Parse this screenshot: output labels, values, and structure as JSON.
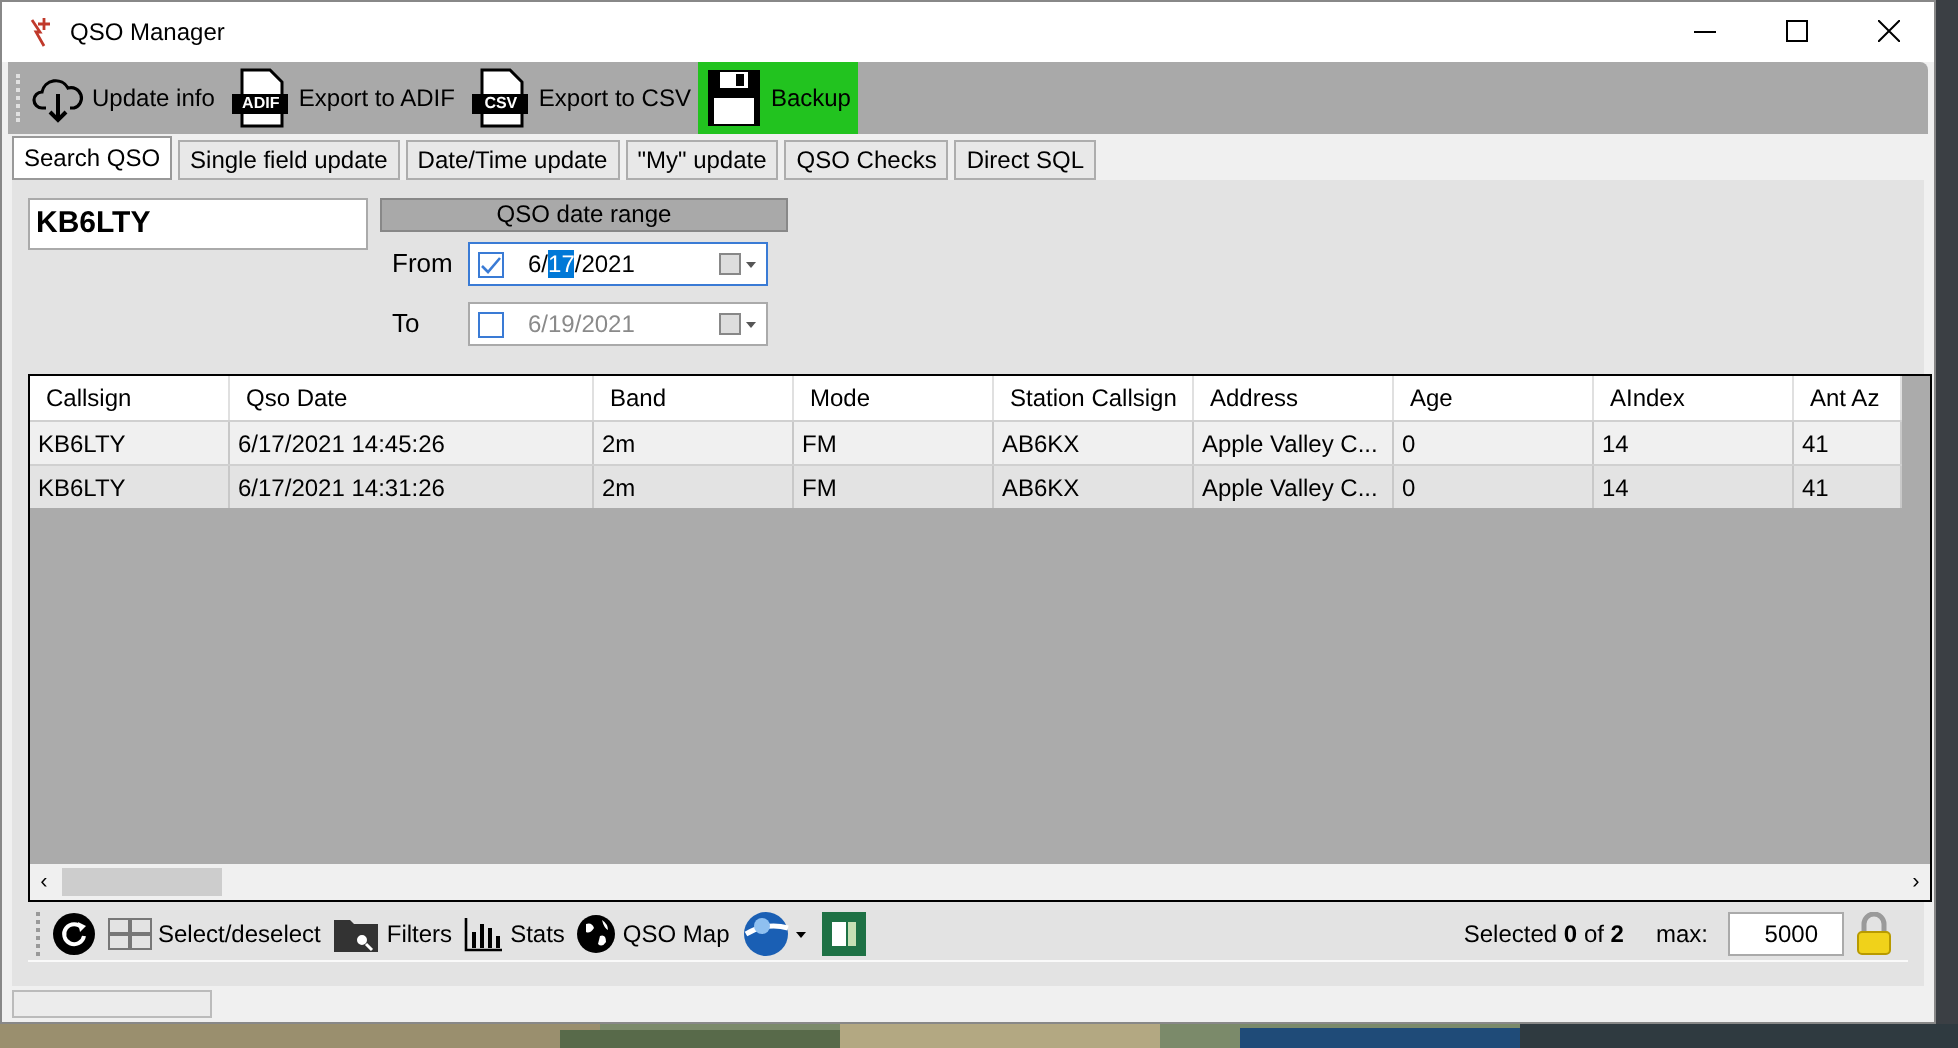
{
  "window": {
    "title": "QSO Manager"
  },
  "toolbar": [
    {
      "label": "Update info",
      "kind": "cloud",
      "highlighted": false
    },
    {
      "label": "Export to ADIF",
      "kind": "file",
      "icon_text": "ADIF",
      "highlighted": false
    },
    {
      "label": "Export to CSV",
      "kind": "file",
      "icon_text": "CSV",
      "highlighted": false
    },
    {
      "label": "Backup",
      "kind": "floppy",
      "highlighted": true
    }
  ],
  "tabs": [
    {
      "label": "Search QSO",
      "selected": true
    },
    {
      "label": "Single field update",
      "selected": false
    },
    {
      "label": "Date/Time update",
      "selected": false
    },
    {
      "label": "\"My\" update",
      "selected": false
    },
    {
      "label": "QSO Checks",
      "selected": false
    },
    {
      "label": "Direct SQL",
      "selected": false
    }
  ],
  "search": {
    "callsign": "KB6LTY",
    "date_range_title": "QSO date range",
    "dates": [
      {
        "label": "From",
        "checked": true,
        "parts": [
          {
            "text": "6/",
            "selected": false
          },
          {
            "text": "17",
            "selected": true
          },
          {
            "text": "/2021",
            "selected": false
          }
        ]
      },
      {
        "label": "To",
        "checked": false,
        "parts": [
          {
            "text": "6/19/2021",
            "selected": false
          }
        ]
      }
    ]
  },
  "table": {
    "columns": [
      "Callsign",
      "Qso Date",
      "Band",
      "Mode",
      "Station Callsign",
      "Address",
      "Age",
      "AIndex",
      "Ant Az"
    ],
    "scroll_left": "‹",
    "scroll_right": "›",
    "rows": [
      [
        "KB6LTY",
        "6/17/2021 14:45:26",
        "2m",
        "FM",
        "AB6KX",
        "Apple Valley C...",
        "0",
        "14",
        "41"
      ],
      [
        "KB6LTY",
        "6/17/2021 14:31:26",
        "2m",
        "FM",
        "AB6KX",
        "Apple Valley C...",
        "0",
        "14",
        "41"
      ]
    ]
  },
  "bottom_toolbar": [
    {
      "kind": "refresh"
    },
    {
      "kind": "grid",
      "label": "Select/deselect"
    },
    {
      "kind": "folder",
      "label": "Filters"
    },
    {
      "kind": "chart",
      "label": "Stats"
    },
    {
      "kind": "globe",
      "label": "QSO Map"
    },
    {
      "kind": "earth"
    },
    {
      "kind": "excel"
    }
  ],
  "selection": {
    "summary": "Selected **0** of **2**",
    "max_label": "max:",
    "max_value": "5000"
  }
}
